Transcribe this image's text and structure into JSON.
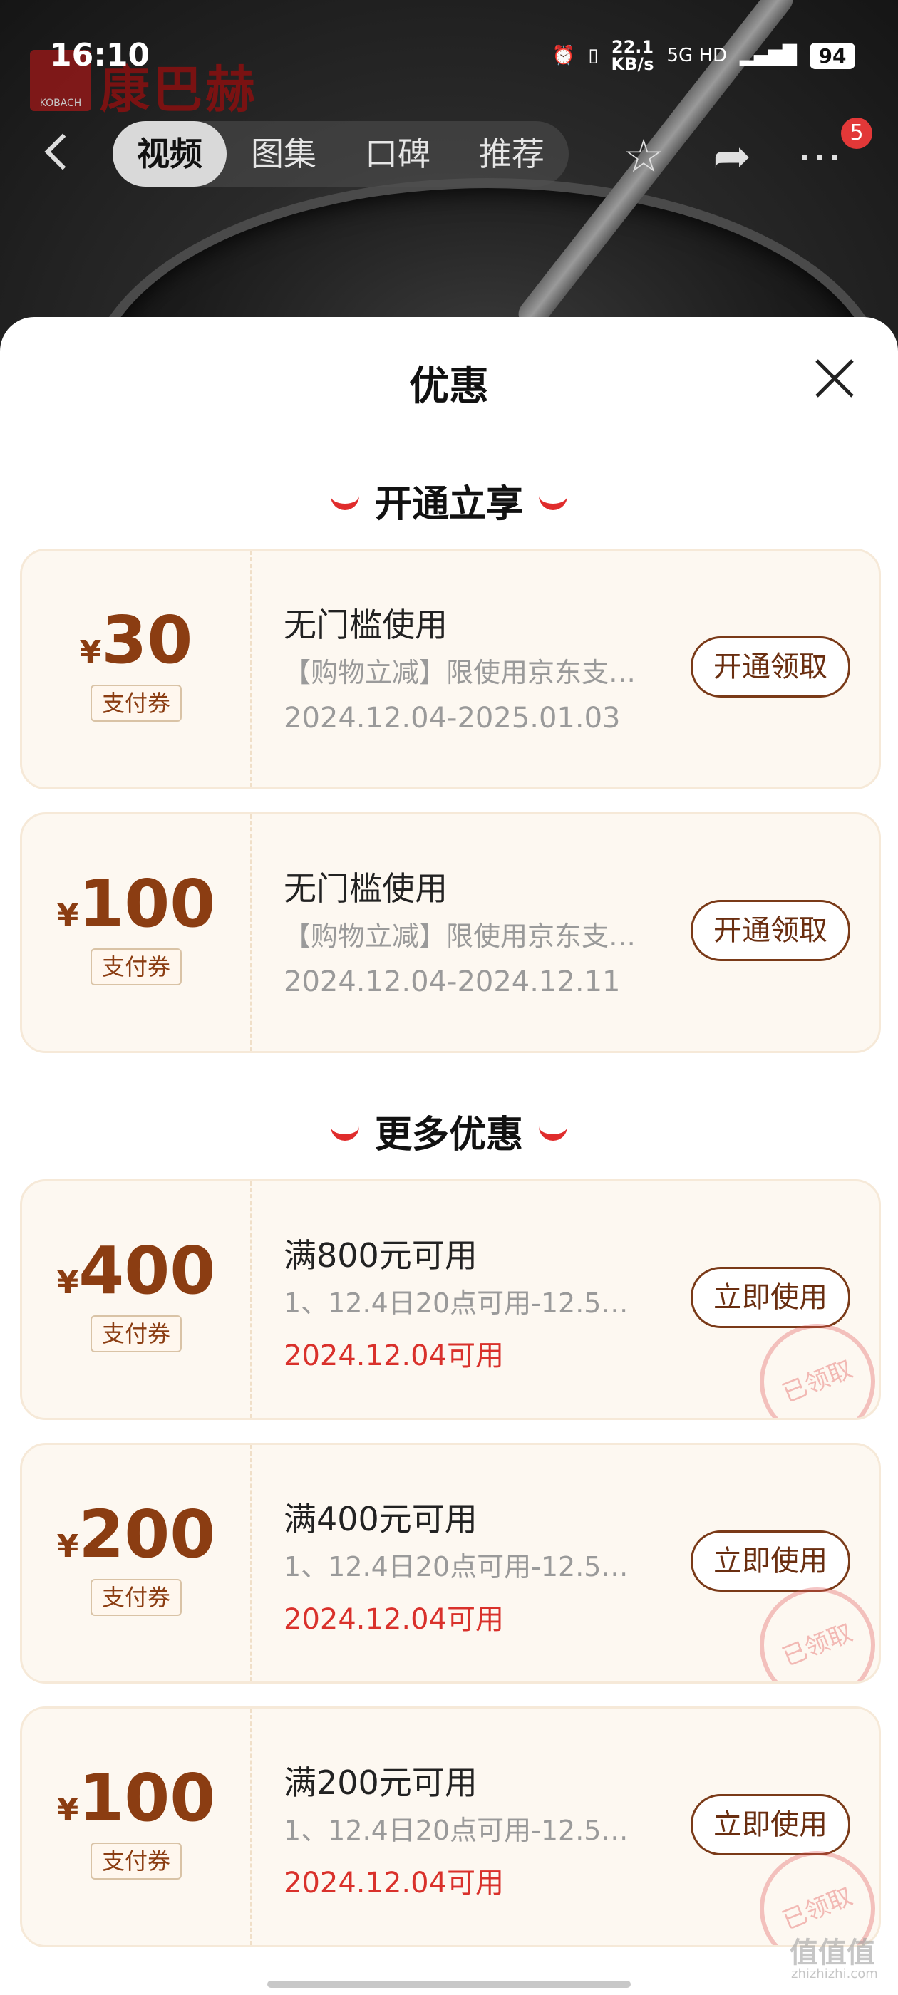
{
  "status_bar": {
    "time": "16:10",
    "speed": "22.1",
    "speed_unit": "KB/s",
    "network": "5G HD",
    "battery": "94"
  },
  "brand": {
    "logo_text": "KOBACH",
    "name": "康巴赫"
  },
  "nav": {
    "tabs": [
      "视频",
      "图集",
      "口碑",
      "推荐"
    ],
    "active_tab": "视频",
    "badge_count": "5",
    "icons": [
      "back-icon",
      "star-icon",
      "share-icon",
      "more-icon"
    ]
  },
  "sheet": {
    "title": "优惠",
    "sections": [
      {
        "heading": "开通立享",
        "coupons": [
          {
            "currency": "¥",
            "amount": "30",
            "tag": "支付券",
            "title": "无门槛使用",
            "desc": "【购物立减】限使用京东支…",
            "date": "2024.12.04-2025.01.03",
            "button": "开通领取"
          },
          {
            "currency": "¥",
            "amount": "100",
            "tag": "支付券",
            "title": "无门槛使用",
            "desc": "【购物立减】限使用京东支…",
            "date": "2024.12.04-2024.12.11",
            "button": "开通领取"
          }
        ]
      },
      {
        "heading": "更多优惠",
        "coupons": [
          {
            "currency": "¥",
            "amount": "400",
            "tag": "支付券",
            "title": "满800元可用",
            "desc": "1、12.4日20点可用-12.5…",
            "date": "2024.12.04可用",
            "button": "立即使用",
            "stamp": "已领取"
          },
          {
            "currency": "¥",
            "amount": "200",
            "tag": "支付券",
            "title": "满400元可用",
            "desc": "1、12.4日20点可用-12.5…",
            "date": "2024.12.04可用",
            "button": "立即使用",
            "stamp": "已领取"
          },
          {
            "currency": "¥",
            "amount": "100",
            "tag": "支付券",
            "title": "满200元可用",
            "desc": "1、12.4日20点可用-12.5…",
            "date": "2024.12.04可用",
            "button": "立即使用",
            "stamp": "已领取"
          }
        ]
      }
    ]
  },
  "watermark": {
    "text": "值值值",
    "sub": "zhizhizhi.com"
  },
  "colors": {
    "accent_red": "#e02c2c",
    "coupon_brown": "#8b3d12",
    "date_red": "#d9312b",
    "coupon_bg": "#fdf8f1"
  }
}
